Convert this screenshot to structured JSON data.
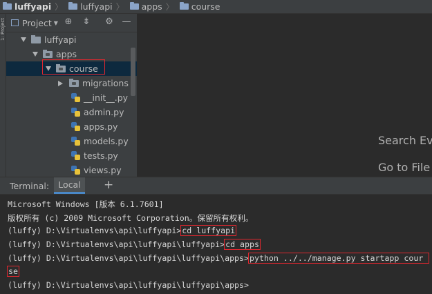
{
  "breadcrumb": {
    "items": [
      "luffyapi",
      "luffyapi",
      "apps",
      "course"
    ]
  },
  "side_tab": {
    "label": "1: Project"
  },
  "project_panel": {
    "title": "Project",
    "dropdown_icon": "chevron-down-icon",
    "header_icons": [
      "crosshair-icon",
      "collapse-icon",
      "gear-icon",
      "minimize-icon"
    ]
  },
  "tree": [
    {
      "label": "luffyapi",
      "type": "folder",
      "expanded": true
    },
    {
      "label": "apps",
      "type": "folder",
      "expanded": true
    },
    {
      "label": "course",
      "type": "folder",
      "expanded": true,
      "selected": true
    },
    {
      "label": "migrations",
      "type": "folder",
      "expanded": false
    },
    {
      "label": "__init__.py",
      "type": "python-file"
    },
    {
      "label": "admin.py",
      "type": "python-file"
    },
    {
      "label": "apps.py",
      "type": "python-file"
    },
    {
      "label": "models.py",
      "type": "python-file"
    },
    {
      "label": "tests.py",
      "type": "python-file"
    },
    {
      "label": "views.py",
      "type": "python-file"
    }
  ],
  "editor": {
    "hint_search": "Search Eve",
    "hint_goto": "Go to File"
  },
  "terminal": {
    "title": "Terminal:",
    "tab": "Local",
    "add_icon": "plus-icon",
    "lines": [
      {
        "text": "Microsoft Windows [版本 6.1.7601]",
        "cmd": ""
      },
      {
        "text": "版权所有 (c) 2009 Microsoft Corporation。保留所有权利。",
        "cmd": ""
      },
      {
        "text": "(luffy) D:\\Virtualenvs\\api\\luffyapi>",
        "cmd": "cd luffyapi"
      },
      {
        "text": "(luffy) D:\\Virtualenvs\\api\\luffyapi\\luffyapi>",
        "cmd": "cd apps"
      },
      {
        "text": "(luffy) D:\\Virtualenvs\\api\\luffyapi\\luffyapi\\apps>",
        "cmd": "python ../../manage.py startapp cour"
      },
      {
        "text": "",
        "cmd": "se"
      },
      {
        "text": "(luffy) D:\\Virtualenvs\\api\\luffyapi\\luffyapi\\apps>",
        "cmd": ""
      }
    ]
  },
  "colors": {
    "highlight_box": "#e0272f",
    "selection": "#0d293e",
    "tab_underline": "#4a88c7"
  }
}
